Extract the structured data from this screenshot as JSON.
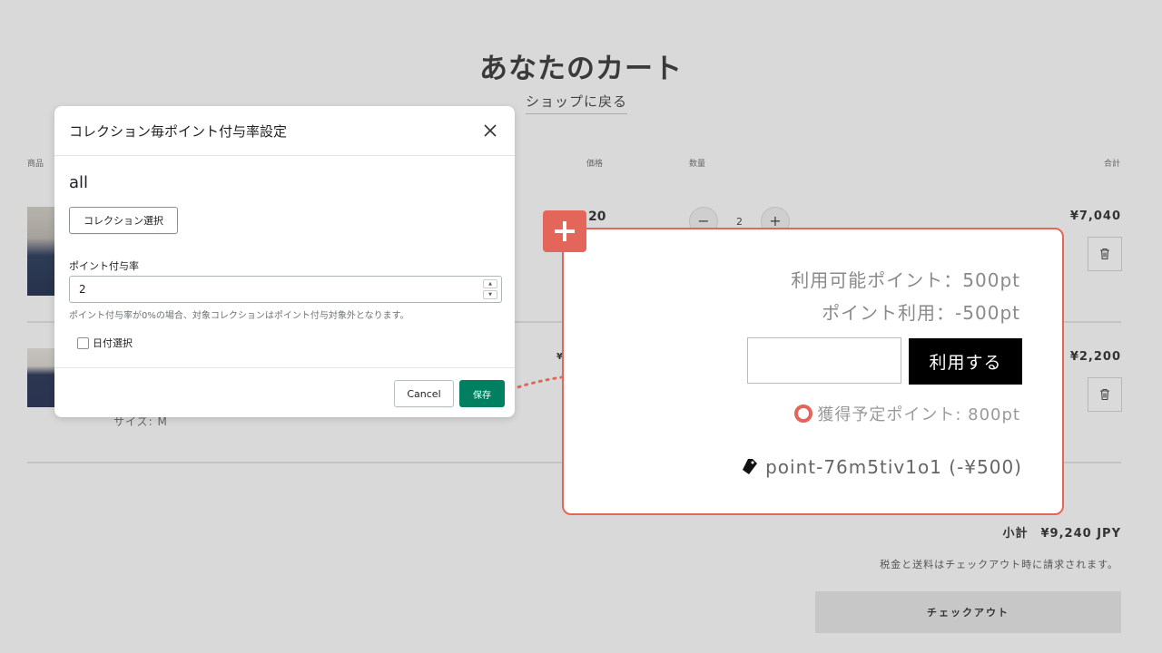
{
  "cart": {
    "title": "あなたのカート",
    "back_link": "ショップに戻る",
    "columns": {
      "product": "商品",
      "price": "価格",
      "quantity": "数量",
      "total": "合計"
    },
    "items": [
      {
        "price_fragment": "20",
        "quantity": "2",
        "total": "¥7,040"
      },
      {
        "price_fragment": "¥",
        "variant": "サイズ: M",
        "total": "¥2,200"
      }
    ],
    "subtotal_label": "小計",
    "subtotal_value": "¥9,240 JPY",
    "tax_note": "税金と送料はチェックアウト時に請求されます。",
    "checkout_label": "チェックアウト"
  },
  "modal": {
    "title": "コレクション毎ポイント付与率設定",
    "collection_name": "all",
    "collection_button": "コレクション選択",
    "rate_label": "ポイント付与率",
    "rate_value": "2",
    "help_text": "ポイント付与率が0%の場合、対象コレクションはポイント付与対象外となります。",
    "date_checkbox_label": "日付選択",
    "cancel_label": "Cancel",
    "save_label": "保存"
  },
  "callout": {
    "available_points": "利用可能ポイント：500pt",
    "points_used": "ポイント利用：-500pt",
    "use_button": "利用する",
    "earned_points": "獲得予定ポイント: 800pt",
    "discount_code": "point-76m5tiv1o1 (-¥500)"
  },
  "colors": {
    "accent": "#e4655a",
    "save_button": "#008060",
    "use_button": "#000000"
  },
  "icons": [
    "close-icon",
    "plus-icon",
    "trash-icon",
    "tag-icon"
  ]
}
